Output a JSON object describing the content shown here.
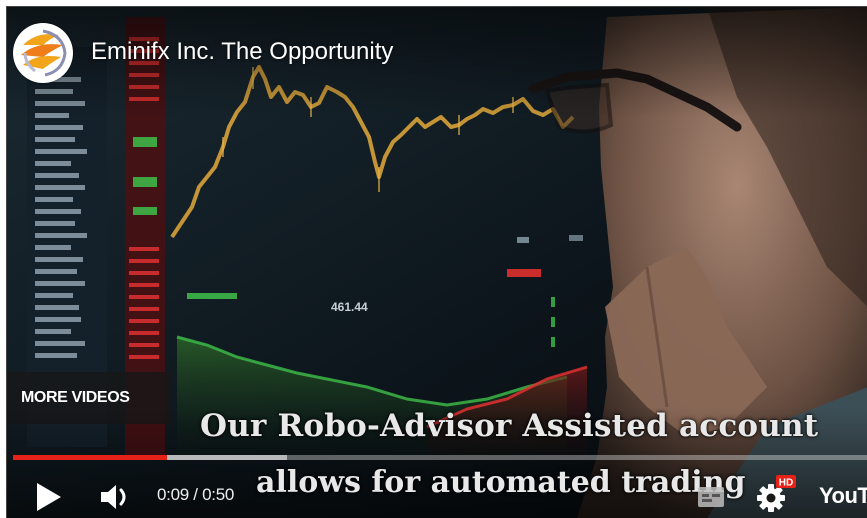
{
  "video": {
    "title": "Eminifx Inc. The Opportunity",
    "more_videos_label": "MORE VIDEOS",
    "captions": [
      "Our Robo-Advisor Assisted account",
      "allows for automated trading"
    ],
    "chart_overlay_value": "461.44"
  },
  "player": {
    "current_time": "0:09",
    "duration": "0:50",
    "time_text": "0:09 / 0:50",
    "progress_fraction": 0.18,
    "buffered_fraction": 0.32,
    "settings_badge": "HD",
    "brand": "YouTube"
  },
  "icons": {
    "channel": "channel-logo-icon",
    "play": "play-icon",
    "volume": "volume-icon",
    "captions": "captions-icon",
    "settings": "gear-icon",
    "brand": "youtube-logo"
  },
  "colors": {
    "progress": "#e62117",
    "hd_badge": "#e62117",
    "chart_line": "#d8a23a",
    "chart_green": "#3fbf4a",
    "chart_red": "#e03030"
  }
}
